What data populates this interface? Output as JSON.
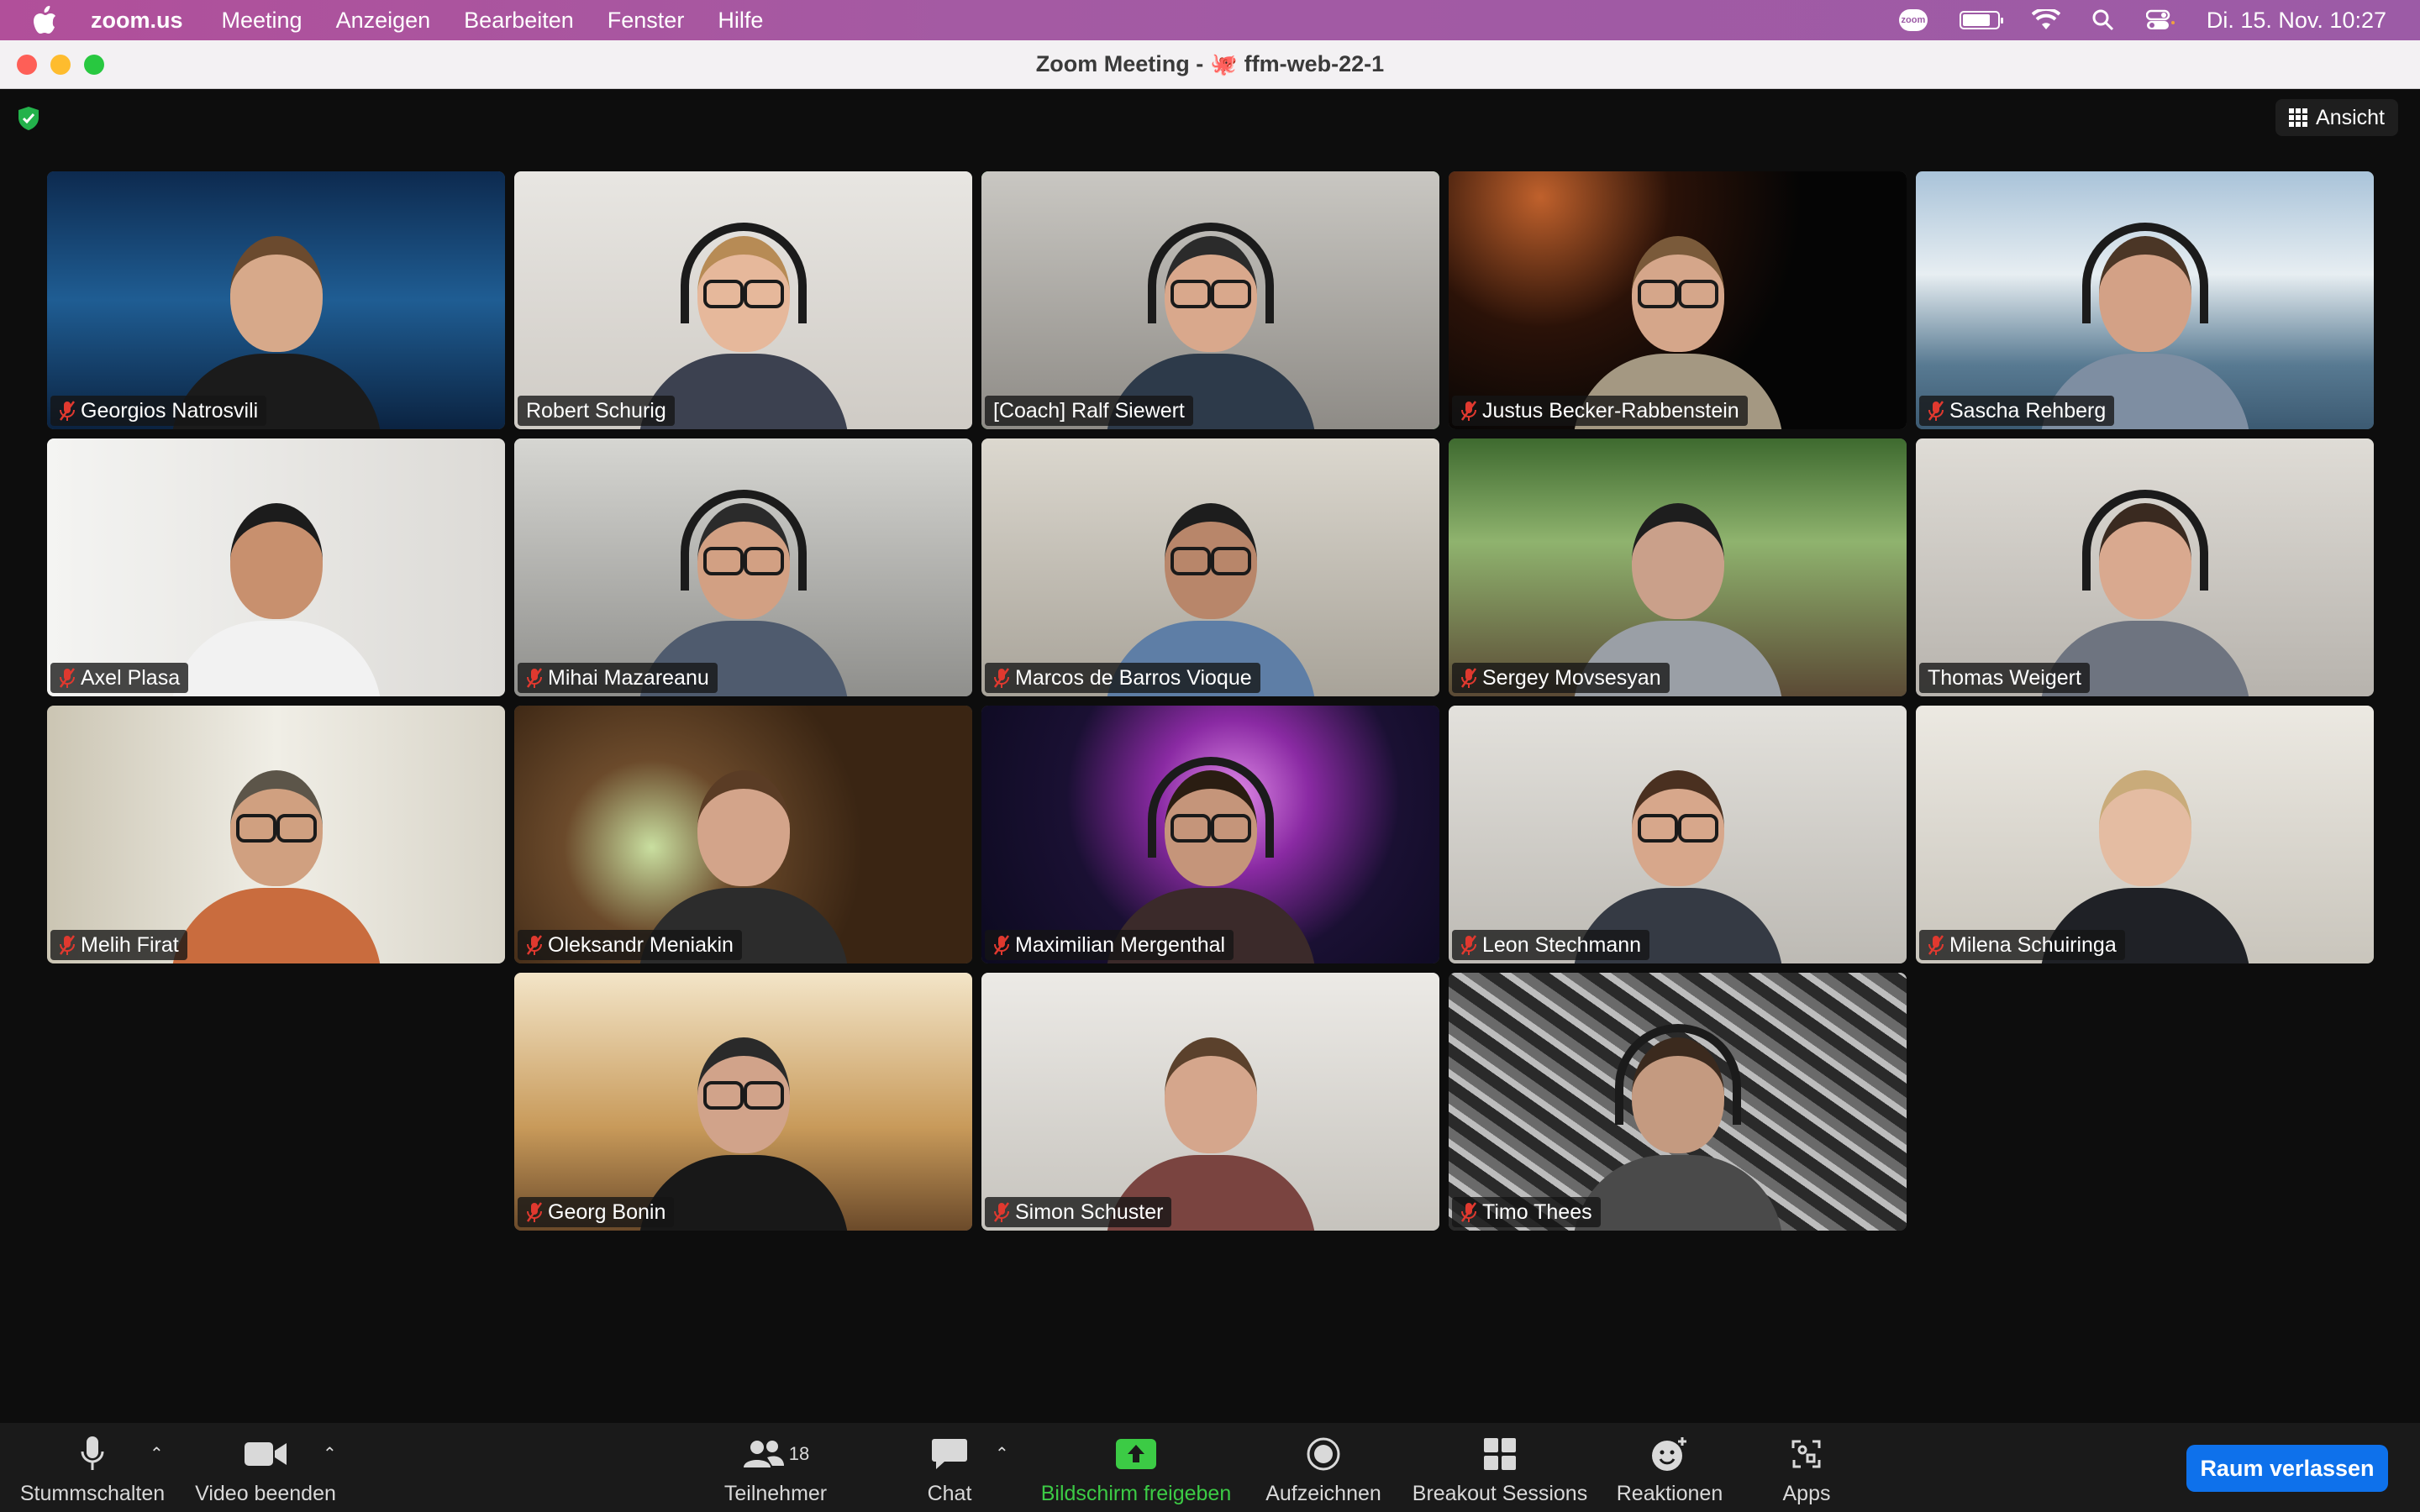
{
  "menubar": {
    "app_name": "zoom.us",
    "items": [
      "Meeting",
      "Anzeigen",
      "Bearbeiten",
      "Fenster",
      "Hilfe"
    ],
    "zoom_pill": "zoom",
    "clock": "Di. 15. Nov.  10:27",
    "battery_level": 0.8
  },
  "window": {
    "title_prefix": "Zoom Meeting - ",
    "title_emoji": "🐙",
    "title_suffix": "ffm-web-22-1"
  },
  "meeting": {
    "view_label": "Ansicht",
    "participants": [
      {
        "name": "Georgios Natrosvili",
        "muted": true,
        "active": false
      },
      {
        "name": "Robert Schurig",
        "muted": false,
        "active": false
      },
      {
        "name": "[Coach] Ralf Siewert",
        "muted": false,
        "active": true
      },
      {
        "name": "Justus Becker-Rabbenstein",
        "muted": true,
        "active": false
      },
      {
        "name": "Sascha Rehberg",
        "muted": true,
        "active": false
      },
      {
        "name": "Axel Plasa",
        "muted": true,
        "active": false
      },
      {
        "name": "Mihai Mazareanu",
        "muted": true,
        "active": false
      },
      {
        "name": "Marcos de Barros Vioque",
        "muted": true,
        "active": false
      },
      {
        "name": "Sergey Movsesyan",
        "muted": true,
        "active": false
      },
      {
        "name": "Thomas Weigert",
        "muted": false,
        "active": false
      },
      {
        "name": "Melih Firat",
        "muted": true,
        "active": false
      },
      {
        "name": "Oleksandr Meniakin",
        "muted": true,
        "active": false
      },
      {
        "name": "Maximilian Mergenthal",
        "muted": true,
        "active": false
      },
      {
        "name": "Leon Stechmann",
        "muted": true,
        "active": false
      },
      {
        "name": "Milena Schuiringa",
        "muted": true,
        "active": false
      },
      {
        "name": "Georg Bonin",
        "muted": true,
        "active": false
      },
      {
        "name": "Simon Schuster",
        "muted": true,
        "active": false
      },
      {
        "name": "Timo Thees",
        "muted": true,
        "active": false
      }
    ]
  },
  "toolbar": {
    "mute_label": "Stummschalten",
    "video_label": "Video beenden",
    "participants_label": "Teilnehmer",
    "participants_count": "18",
    "chat_label": "Chat",
    "share_label": "Bildschirm freigeben",
    "record_label": "Aufzeichnen",
    "breakout_label": "Breakout Sessions",
    "reactions_label": "Reaktionen",
    "apps_label": "Apps",
    "leave_label": "Raum verlassen"
  },
  "colors": {
    "active_speaker": "#3fc84a",
    "share_green": "#3ccb45",
    "leave_blue": "#0e71eb",
    "mute_red": "#e0392f"
  }
}
